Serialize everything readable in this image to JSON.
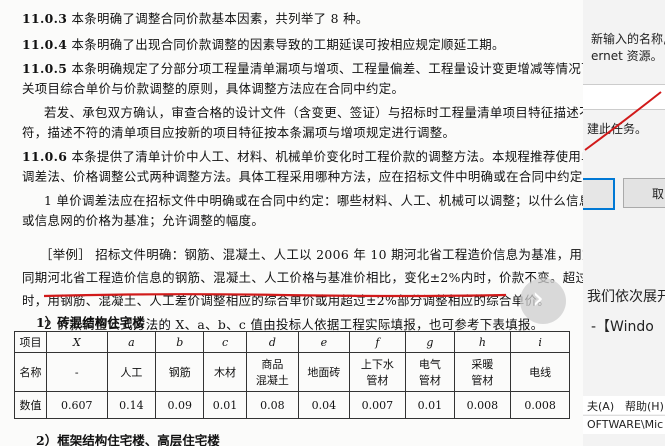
{
  "document": {
    "lines": [
      {
        "text": "11.0.3 本条明确了调整合同价款基本因素，共列举了 8 种。",
        "bold_prefix": "11.0.3"
      },
      {
        "text": "11.0.4 本条明确了出现合同价款调整的因素导致的工期延误可按相应规定顺延工期。",
        "bold_prefix": "11.0.4"
      },
      {
        "text": "11.0.5 本条明确规定了分部分项工程量清单漏项与增项、工程量偏差、工程量设计变更增减等情况下相",
        "bold_prefix": "11.0.5"
      },
      {
        "text": "关项目综合单价与价款调整的原则，具体调整方法应在合同中约定。",
        "bold_prefix": ""
      },
      {
        "text": "若发、承包双方确认，审查合格的设计文件（含变更、签证）与招标时工程量清单项目特征描述不",
        "bold_prefix": ""
      },
      {
        "text": "符，描述不符的清单项目应按新的项目特征按本条漏项与增项规定进行调整。",
        "bold_prefix": ""
      },
      {
        "text": "11.0.6 本条提供了清单计价中人工、材料、机械单价变化时工程价款的调整方法。本规程推荐使用单价",
        "bold_prefix": "11.0.6"
      },
      {
        "text": "调差法、价格调整公式两种调整方法。具体工程采用哪种方法，应在招标文件中明确或在合同中约定。",
        "bold_prefix": ""
      },
      {
        "text": "1 单价调差法应在招标文件中明确或在合同中约定：哪些材料、人工、机械可以调整；以什么信息",
        "bold_prefix": ""
      },
      {
        "text": "或信息网的价格为基准；允许调整的幅度。",
        "bold_prefix": ""
      },
      {
        "text": "［举例］ 招标文件明确：钢筋、混凝土、人工以 2006 年 10 期河北省工程造价信息为基准，用施工",
        "bold_prefix": ""
      },
      {
        "text": "同期河北省工程造价信息的钢筋、混凝土、人工价格与基准价相比，变化±2%内时，价款不变。超过±2%",
        "bold_prefix": ""
      },
      {
        "text": "时，用钢筋、混凝土、人工差价调整相应的综合单价或用超过±2%部分调整相应的综合单价。",
        "bold_prefix": ""
      },
      {
        "text": "2 价款调整公式方法的 X、a、b、c 值由投标人依据工程实际填报，也可参考下表填报。",
        "bold_prefix": ""
      }
    ],
    "subheading1": "1）砖混结构住宅楼",
    "subheading2": "2）框架结构住宅楼、高层住宅楼",
    "table": {
      "row1": [
        "项目",
        "X",
        "a",
        "b",
        "c",
        "d",
        "e",
        "f",
        "g",
        "h",
        "i"
      ],
      "row2": [
        "名称",
        "-",
        "人工",
        "钢筋",
        "木材",
        "商品\n混凝土",
        "地面砖",
        "上下水\n管材",
        "电气\n管材",
        "采暖\n管材",
        "电线"
      ],
      "row3": [
        "数值",
        "0.607",
        "0.14",
        "0.09",
        "0.01",
        "0.08",
        "0.04",
        "0.007",
        "0.01",
        "0.008",
        "0.008"
      ]
    },
    "next_glyph": "›"
  },
  "right_panel": {
    "text1": "新输入的名称,",
    "text2": "ernet 资源。",
    "text3": "建此任务。",
    "button_label": "取",
    "text4": "我们依次展开",
    "text5": "-【Windo",
    "menu1": "夫(A)",
    "menu2": "帮助(H)",
    "path": "OFTWARE\\Mic",
    "accent": "#0078d4",
    "annotation_color": "#d11a1a"
  }
}
